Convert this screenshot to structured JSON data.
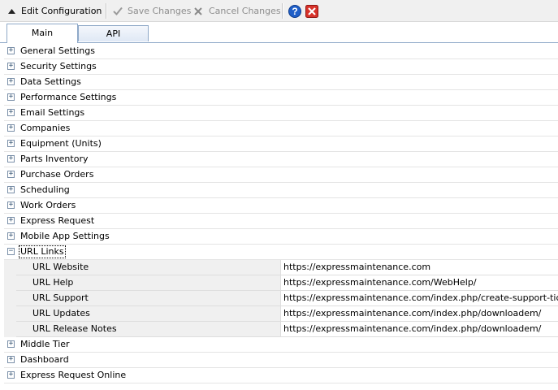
{
  "toolbar": {
    "title": "Edit Configuration",
    "save_label": "Save Changes",
    "cancel_label": "Cancel Changes"
  },
  "tabs": [
    {
      "label": "Main",
      "active": true
    },
    {
      "label": "API",
      "active": false
    }
  ],
  "categories": [
    {
      "label": "General Settings",
      "expanded": false
    },
    {
      "label": "Security Settings",
      "expanded": false
    },
    {
      "label": "Data Settings",
      "expanded": false
    },
    {
      "label": "Performance Settings",
      "expanded": false
    },
    {
      "label": "Email Settings",
      "expanded": false
    },
    {
      "label": "Companies",
      "expanded": false
    },
    {
      "label": "Equipment (Units)",
      "expanded": false
    },
    {
      "label": "Parts Inventory",
      "expanded": false
    },
    {
      "label": "Purchase Orders",
      "expanded": false
    },
    {
      "label": "Scheduling",
      "expanded": false
    },
    {
      "label": "Work Orders",
      "expanded": false
    },
    {
      "label": "Express Request",
      "expanded": false
    },
    {
      "label": "Mobile App Settings",
      "expanded": false
    },
    {
      "label": "URL Links",
      "expanded": true,
      "properties": [
        {
          "name": "URL Website",
          "value": "https://expressmaintenance.com"
        },
        {
          "name": "URL Help",
          "value": "https://expressmaintenance.com/WebHelp/"
        },
        {
          "name": "URL Support",
          "value": "https://expressmaintenance.com/index.php/create-support-ticket/"
        },
        {
          "name": "URL Updates",
          "value": "https://expressmaintenance.com/index.php/downloadem/"
        },
        {
          "name": "URL Release Notes",
          "value": "https://expressmaintenance.com/index.php/downloadem/"
        }
      ]
    },
    {
      "label": "Middle Tier",
      "expanded": false
    },
    {
      "label": "Dashboard",
      "expanded": false
    },
    {
      "label": "Express Request Online",
      "expanded": false
    }
  ],
  "icons": {
    "collapse": "triangle-up-icon",
    "save": "checkmark-icon",
    "cancel": "x-icon",
    "help": "help-icon",
    "close": "close-icon"
  },
  "colors": {
    "help_blue": "#1f5fc8",
    "close_red": "#d7322a",
    "tab_border": "#8fa9c8"
  }
}
